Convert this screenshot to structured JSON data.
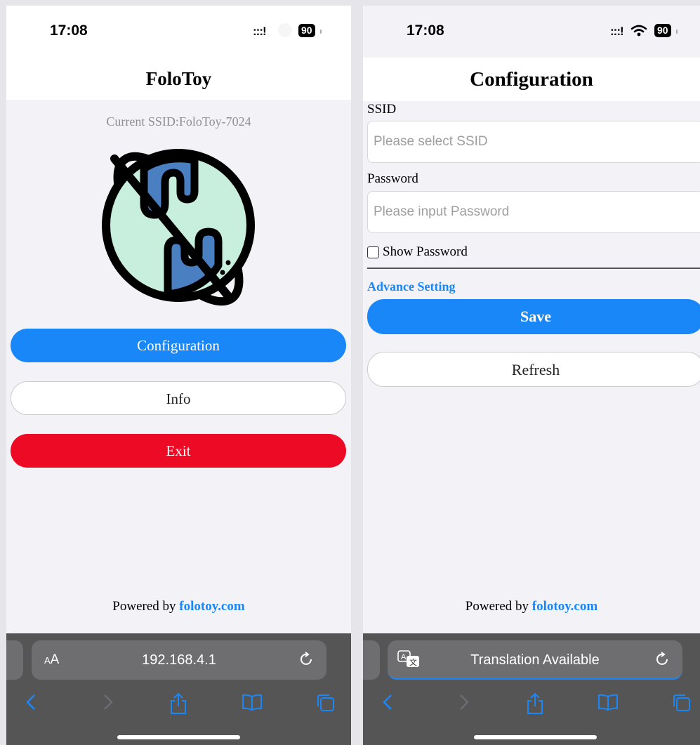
{
  "left_screen": {
    "status": {
      "time": "17:08",
      "signal": ":::!",
      "battery": "90"
    },
    "title": "FoloToy",
    "current_ssid": "Current SSID:FoloToy-7024",
    "buttons": {
      "configuration": "Configuration",
      "info": "Info",
      "exit": "Exit"
    },
    "footer": {
      "prefix": "Powered by",
      "link": "folotoy.com"
    },
    "safari": {
      "aa": "AA",
      "url": "192.168.4.1"
    }
  },
  "right_screen": {
    "status": {
      "time": "17:08",
      "signal": ":::!",
      "battery": "90"
    },
    "title": "Configuration",
    "form": {
      "ssid_label": "SSID",
      "ssid_placeholder": "Please select SSID",
      "password_label": "Password",
      "password_placeholder": "Please input Password",
      "show_password": "Show Password",
      "advance_setting": "Advance Setting",
      "save": "Save",
      "refresh": "Refresh"
    },
    "footer": {
      "prefix": "Powered by",
      "link": "folotoy.com"
    },
    "safari": {
      "url": "Translation Available"
    }
  },
  "colors": {
    "accent": "#1a87f8",
    "danger": "#ec0a25",
    "globe_fill": "#c8eedd",
    "globe_land": "#4a7fc1"
  },
  "icons": [
    "signal-icon",
    "wifi-icon",
    "battery-icon",
    "globe-logo-icon",
    "reload-icon",
    "translate-icon",
    "back-icon",
    "forward-icon",
    "share-icon",
    "bookmarks-icon",
    "tabs-icon"
  ]
}
